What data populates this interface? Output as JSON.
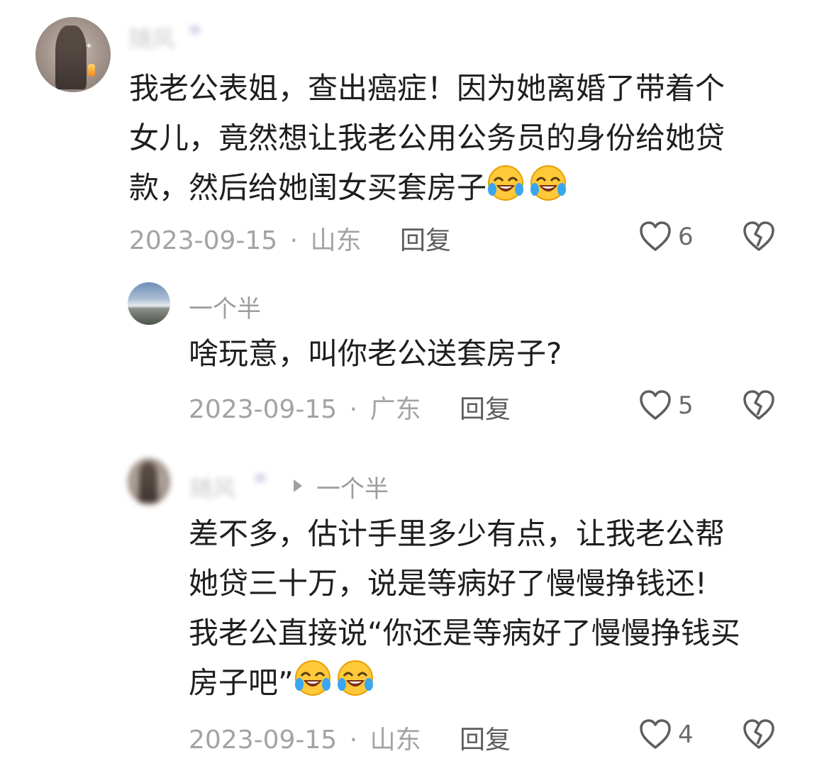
{
  "comments": [
    {
      "username": "随风",
      "content_lines": [
        "我老公表姐，查出癌症！因为她离婚了带着个",
        "女儿，竟然想让我老公用公务员的身份给她贷",
        "款，然后给她闺女买套房子"
      ],
      "date": "2023-09-15",
      "separator": "·",
      "location": "山东",
      "reply_label": "回复",
      "likes": "6",
      "emoji": "rolling-on-floor-laughing"
    },
    {
      "username": "一个半",
      "content_lines": [
        "啥玩意，叫你老公送套房子?"
      ],
      "date": "2023-09-15",
      "separator": "·",
      "location": "广东",
      "reply_label": "回复",
      "likes": "5"
    },
    {
      "username": "随风",
      "reply_to": "一个半",
      "content_lines": [
        "差不多，估计手里多少有点，让我老公帮",
        "她贷三十万，说是等病好了慢慢挣钱还!",
        "我老公直接说“你还是等病好了慢慢挣钱买",
        "房子吧”"
      ],
      "date": "2023-09-15",
      "separator": "·",
      "location": "山东",
      "reply_label": "回复",
      "likes": "4",
      "emoji": "rolling-on-floor-laughing"
    }
  ],
  "colors": {
    "meta_gray": "#a3a3a3",
    "text_dark": "#1e1e1e",
    "emoji_yellow": "#ffc93a",
    "emoji_tears": "#3aa6ef"
  },
  "icons": {
    "like": "heart-outline-icon",
    "dislike": "broken-heart-icon",
    "reply_arrow": "caret-right-icon"
  }
}
